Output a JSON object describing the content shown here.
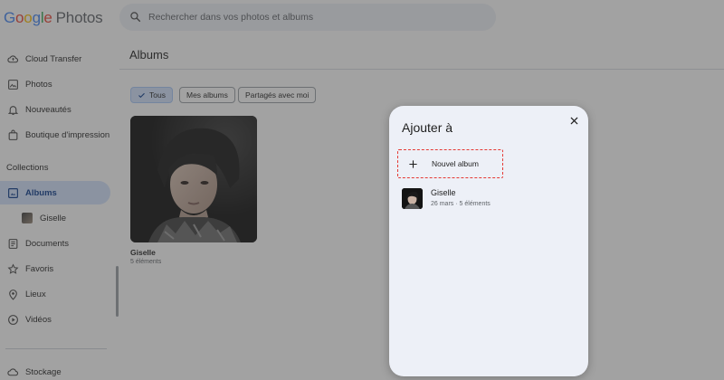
{
  "header": {
    "logo_letters": [
      "G",
      "o",
      "o",
      "g",
      "l",
      "e"
    ],
    "logo_product": "Photos",
    "search_placeholder": "Rechercher dans vos photos et albums"
  },
  "sidebar": {
    "items": [
      {
        "label": "Cloud Transfer",
        "icon": "cloud-transfer-icon"
      },
      {
        "label": "Photos",
        "icon": "photo-icon"
      },
      {
        "label": "Nouveautés",
        "icon": "bell-icon"
      },
      {
        "label": "Boutique d'impression",
        "icon": "shopping-bag-icon"
      }
    ],
    "collections_label": "Collections",
    "collections": [
      {
        "label": "Albums",
        "icon": "album-icon",
        "active": true
      },
      {
        "label": "Giselle",
        "icon": "album-cover-thumb",
        "sub": true
      },
      {
        "label": "Documents",
        "icon": "document-icon"
      },
      {
        "label": "Favoris",
        "icon": "star-icon"
      },
      {
        "label": "Lieux",
        "icon": "location-pin-icon"
      },
      {
        "label": "Vidéos",
        "icon": "play-circle-icon"
      }
    ],
    "storage_label": "Stockage"
  },
  "main": {
    "title": "Albums",
    "chips": [
      {
        "label": "Tous",
        "selected": true
      },
      {
        "label": "Mes albums",
        "selected": false
      },
      {
        "label": "Partagés avec moi",
        "selected": false
      }
    ],
    "album": {
      "name": "Giselle",
      "count": "5 éléments"
    }
  },
  "dialog": {
    "title": "Ajouter à",
    "new_album_label": "Nouvel album",
    "albums": [
      {
        "name": "Giselle",
        "date": "26 mars",
        "separator": "·",
        "count": "5 éléments"
      }
    ]
  },
  "colors": {
    "accent": "#d3e3fd",
    "highlight_border": "#e53935",
    "dialog_bg": "#edf0f7",
    "scrim": "#3c3c3c"
  }
}
